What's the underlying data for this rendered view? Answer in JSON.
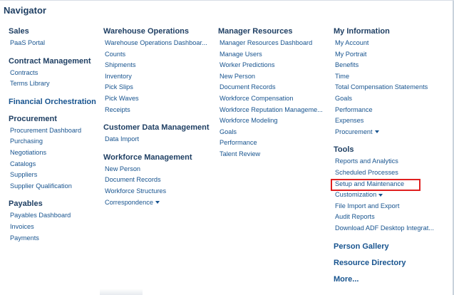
{
  "navigator": {
    "title": "Navigator",
    "columns": [
      {
        "groups": [
          {
            "title": "Sales",
            "items": [
              "PaaS Portal"
            ]
          },
          {
            "title": "Contract Management",
            "items": [
              "Contracts",
              "Terms Library"
            ]
          },
          {
            "title": "Financial Orchestration",
            "items": []
          },
          {
            "title": "Procurement",
            "items": [
              "Procurement Dashboard",
              "Purchasing",
              "Negotiations",
              "Catalogs",
              "Suppliers",
              "Supplier Qualification"
            ]
          },
          {
            "title": "Payables",
            "items": [
              "Payables Dashboard",
              "Invoices",
              "Payments"
            ]
          }
        ]
      },
      {
        "groups": [
          {
            "title": "Warehouse Operations",
            "items": [
              "Warehouse Operations Dashboar...",
              "Counts",
              "Shipments",
              "Inventory",
              "Pick Slips",
              "Pick Waves",
              "Receipts"
            ]
          },
          {
            "title": "Customer Data Management",
            "items": [
              "Data Import"
            ]
          },
          {
            "title": "Workforce Management",
            "items": [
              "New Person",
              "Document Records",
              "Workforce Structures",
              "Correspondence"
            ]
          }
        ]
      },
      {
        "groups": [
          {
            "title": "Manager Resources",
            "items": [
              "Manager Resources Dashboard",
              "Manage Users",
              "Worker Predictions",
              "New Person",
              "Document Records",
              "Workforce Compensation",
              "Workforce Reputation Manageme...",
              "Workforce Modeling",
              "Goals",
              "Performance",
              "Talent Review"
            ]
          }
        ]
      },
      {
        "groups": [
          {
            "title": "My Information",
            "items": [
              "My Account",
              "My Portrait",
              "Benefits",
              "Time",
              "Total Compensation Statements",
              "Goals",
              "Performance",
              "Expenses",
              "Procurement"
            ]
          },
          {
            "title": "Tools",
            "items": [
              "Reports and Analytics",
              "Scheduled Processes",
              "Setup and Maintenance",
              "Customization",
              "File Import and Export",
              "Audit Reports",
              "Download ADF Desktop Integrat..."
            ]
          }
        ],
        "bottom_links": [
          "Person Gallery",
          "Resource Directory",
          "More..."
        ]
      }
    ]
  },
  "colors": {
    "heading": "#1f3f63",
    "link": "#18548f",
    "highlight": "#e02020"
  }
}
